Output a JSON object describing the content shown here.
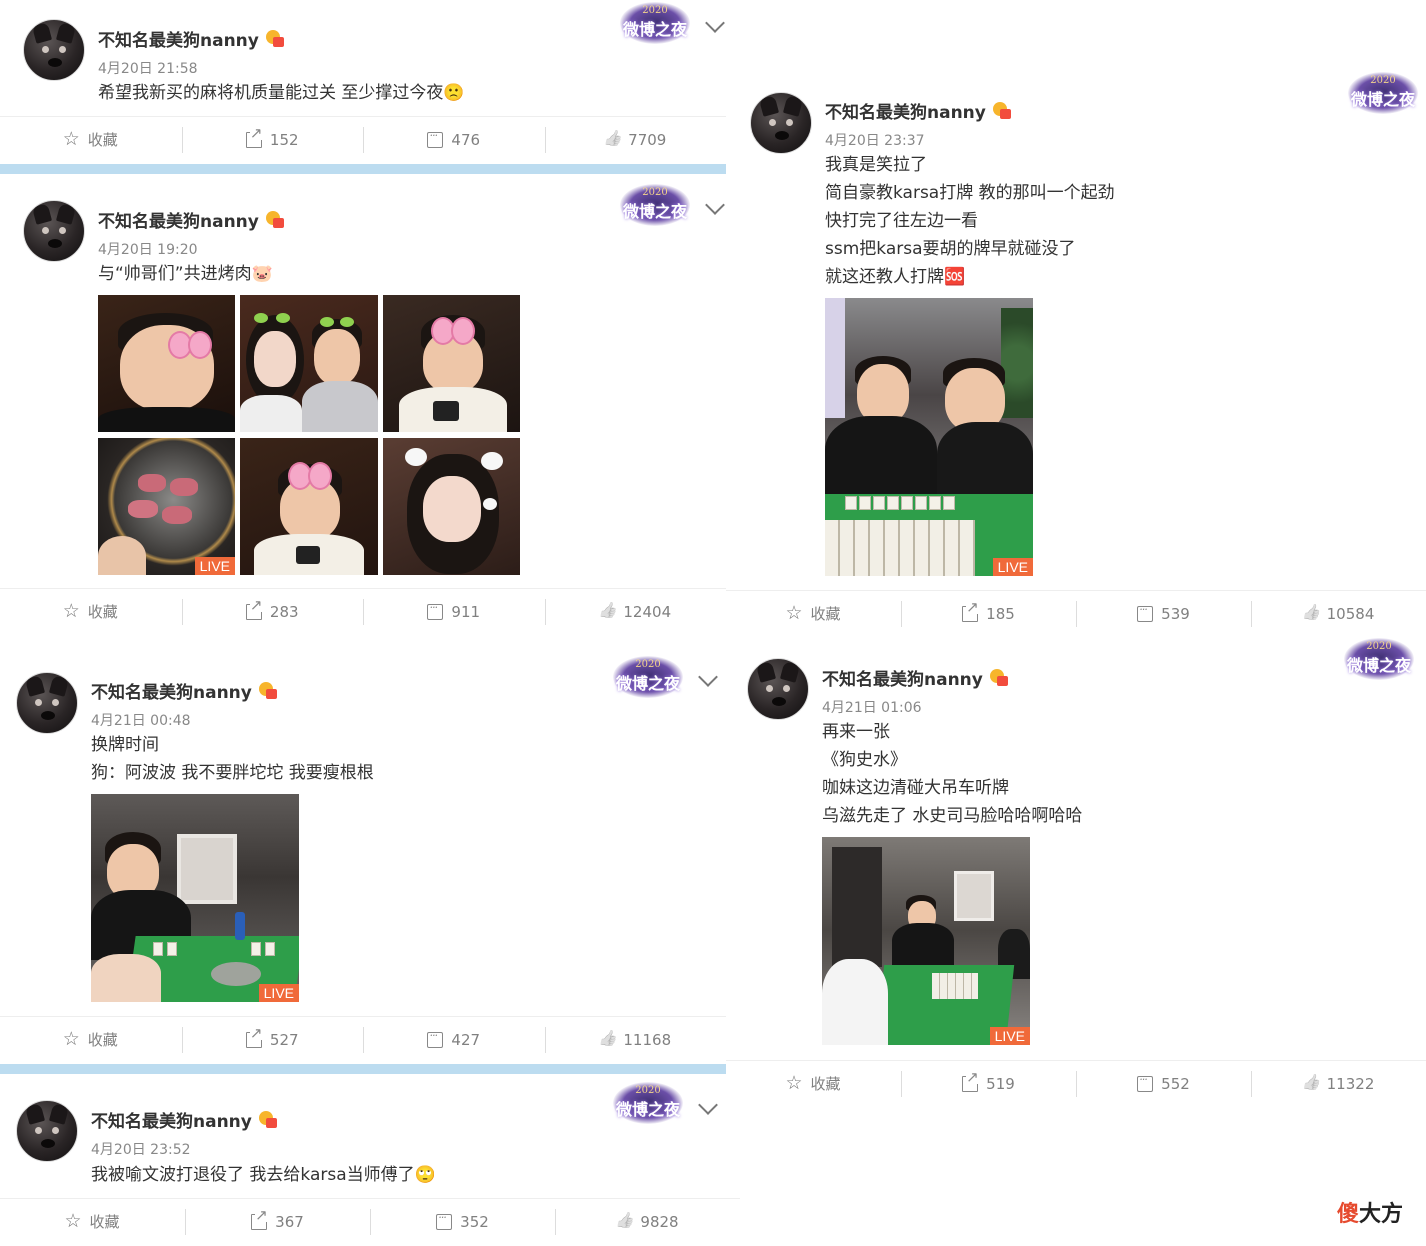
{
  "user": {
    "name": "不知名最美狗nanny"
  },
  "badge": {
    "year": "2020",
    "name": "微博之夜"
  },
  "posts": [
    {
      "time": "4月20日 21:58",
      "lines": [
        "希望我新买的麻将机质量能过关 至少撑过今夜🙁"
      ],
      "actions": {
        "favorite": "收藏",
        "share": "152",
        "comment": "476",
        "like": "7709"
      }
    },
    {
      "time": "4月20日 19:20",
      "lines": [
        "与“帅哥们”共进烤肉🐷"
      ],
      "live_label": "LIVE",
      "actions": {
        "favorite": "收藏",
        "share": "283",
        "comment": "911",
        "like": "12404"
      }
    },
    {
      "time": "4月21日 00:48",
      "lines": [
        "换牌时间",
        "狗：阿波波 我不要胖坨坨 我要瘦根根"
      ],
      "live_label": "LIVE",
      "actions": {
        "favorite": "收藏",
        "share": "527",
        "comment": "427",
        "like": "11168"
      }
    },
    {
      "time": "4月20日 23:52",
      "lines": [
        "我被喻文波打退役了 我去给karsa当师傅了🙄"
      ],
      "actions": {
        "favorite": "收藏",
        "share": "367",
        "comment": "352",
        "like": "9828"
      }
    },
    {
      "time": "4月20日 23:37",
      "lines": [
        "我真是笑拉了",
        "简自豪教karsa打牌 教的那叫一个起劲",
        "快打完了往左边一看",
        "ssm把karsa要胡的牌早就碰没了",
        "就这还教人打牌🆘"
      ],
      "live_label": "LIVE",
      "actions": {
        "favorite": "收藏",
        "share": "185",
        "comment": "539",
        "like": "10584"
      }
    },
    {
      "time": "4月21日 01:06",
      "lines": [
        "再来一张",
        "《狗史水》",
        "咖妹这边清碰大吊车听牌",
        "乌滋先走了 水史司马脸哈哈啊哈哈"
      ],
      "live_label": "LIVE",
      "actions": {
        "favorite": "收藏",
        "share": "519",
        "comment": "552",
        "like": "11322"
      }
    }
  ],
  "watermark": {
    "red": "傻",
    "black": "大方"
  },
  "colors": {
    "divider": "#bcdcf0",
    "live": "#f06a3a",
    "table_felt": "#2e9e4a"
  }
}
